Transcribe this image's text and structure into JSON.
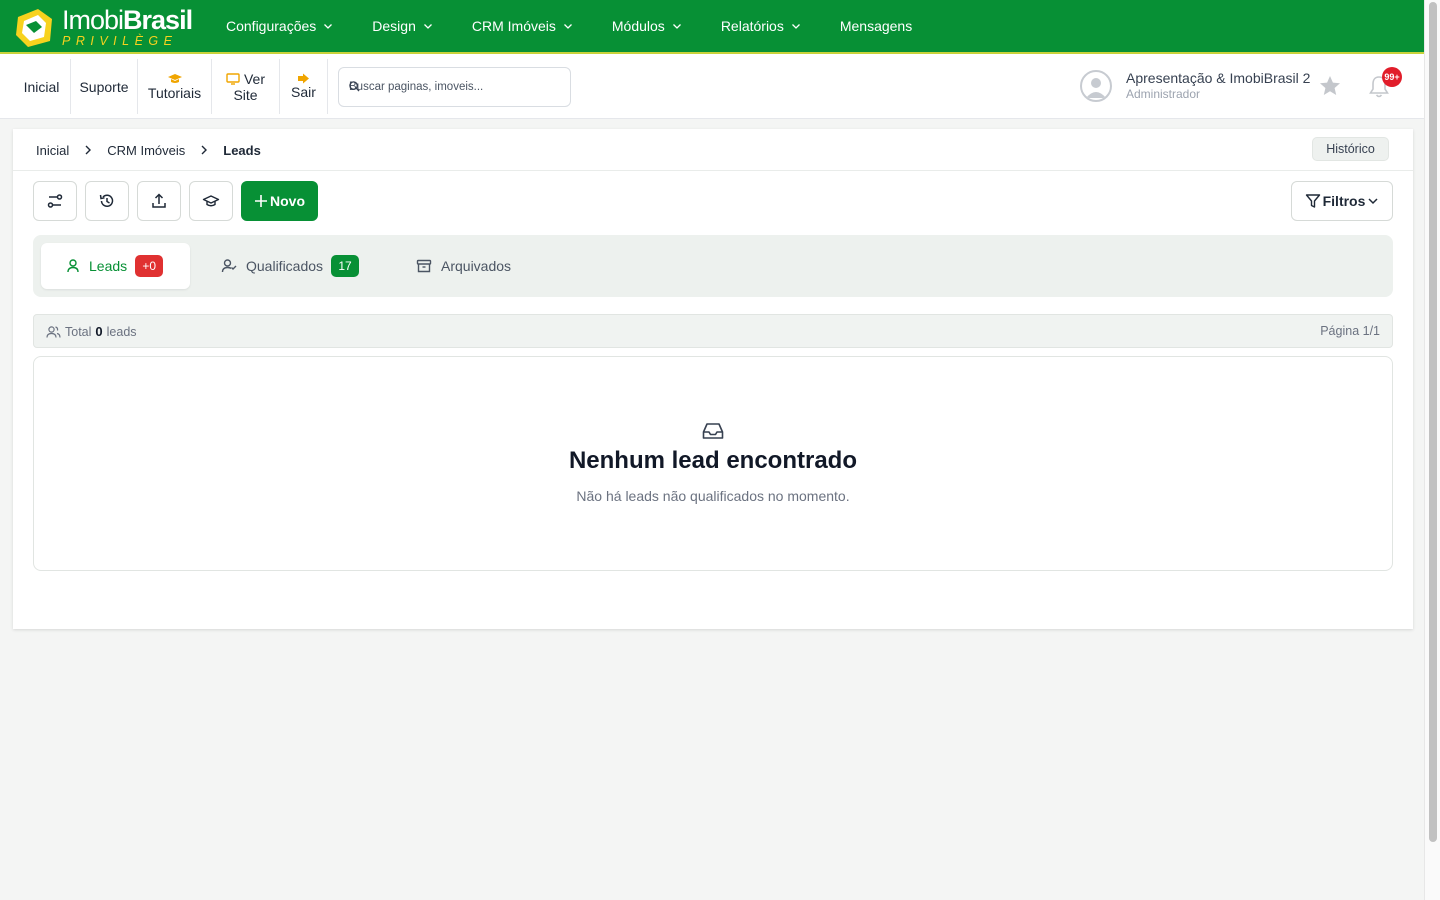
{
  "brand": {
    "name_light": "Imobi",
    "name_bold": "Brasil",
    "tagline": "PRIVILÈGE",
    "colors": {
      "primary": "#079035",
      "accent": "#f7d21e"
    }
  },
  "nav": [
    {
      "label": "Configurações"
    },
    {
      "label": "Design"
    },
    {
      "label": "CRM Imóveis"
    },
    {
      "label": "Módulos"
    },
    {
      "label": "Relatórios"
    },
    {
      "label": "Mensagens"
    }
  ],
  "quick": {
    "inicial": "Inicial",
    "suporte": "Suporte",
    "tutoriais": "Tutoriais",
    "ver_site_1": "Ver",
    "ver_site_2": "Site",
    "sair": "Sair"
  },
  "search": {
    "placeholder": "Buscar paginas, imoveis..."
  },
  "user": {
    "name": "Apresentação & ImobiBrasil 2",
    "role": "Administrador",
    "notifications": "99+"
  },
  "breadcrumb": {
    "items": [
      "Inicial",
      "CRM Imóveis"
    ],
    "current": "Leads",
    "history_button": "Histórico"
  },
  "actions": {
    "novo": "Novo",
    "filtros": "Filtros"
  },
  "tabs": [
    {
      "label": "Leads",
      "badge": "+0",
      "badge_color": "#e03131"
    },
    {
      "label": "Qualificados",
      "badge": "17",
      "badge_color": "#079035"
    },
    {
      "label": "Arquivados"
    }
  ],
  "summary": {
    "prefix": "Total",
    "count": "0",
    "suffix": "leads",
    "page": "Página 1/1"
  },
  "empty_state": {
    "title": "Nenhum lead encontrado",
    "message": "Não há leads não qualificados no momento."
  }
}
